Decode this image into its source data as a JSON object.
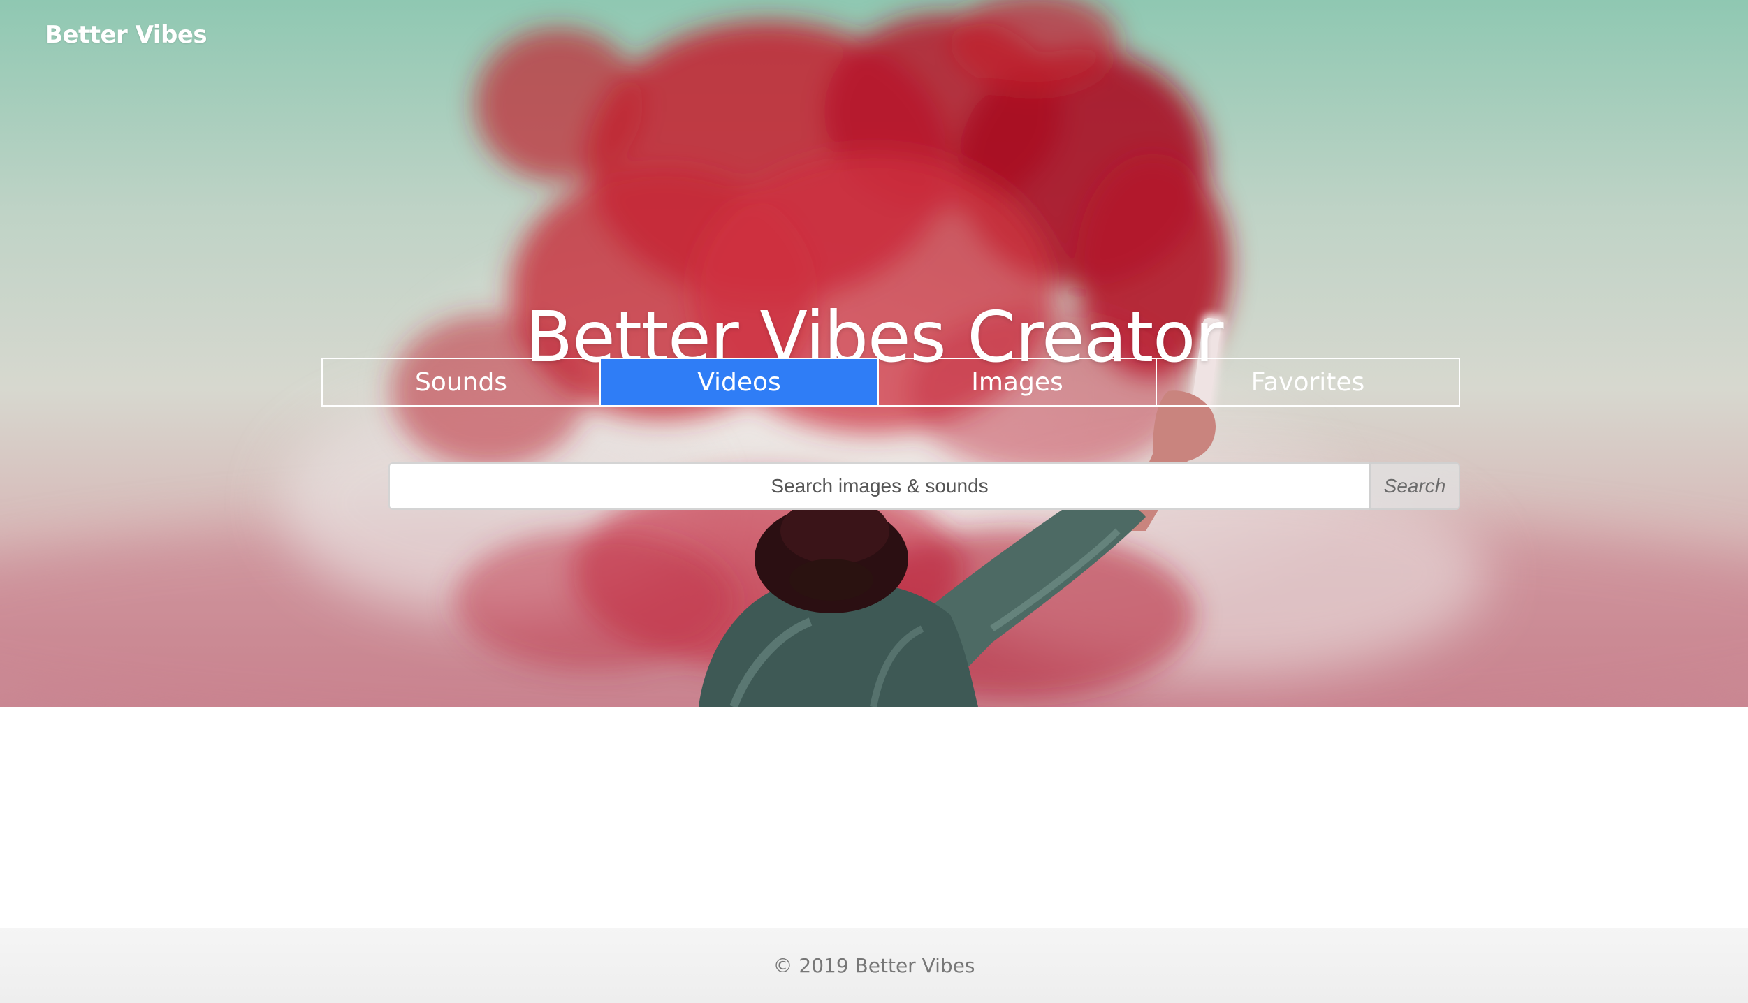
{
  "brand": {
    "name": "Better Vibes"
  },
  "hero": {
    "title": "Better Vibes Creator",
    "background_image": "red-smoke-flare-photo"
  },
  "tabs": [
    {
      "label": "Sounds",
      "active": false
    },
    {
      "label": "Videos",
      "active": true
    },
    {
      "label": "Images",
      "active": false
    },
    {
      "label": "Favorites",
      "active": false
    }
  ],
  "search": {
    "placeholder": "Search images & sounds",
    "value": "",
    "button_label": "Search"
  },
  "footer": {
    "copyright": "© 2019 Better Vibes"
  },
  "colors": {
    "active_tab": "#2f7df6",
    "tab_border": "#ffffff",
    "footer_bg": "#f3f3f3",
    "footer_text": "#777777"
  }
}
